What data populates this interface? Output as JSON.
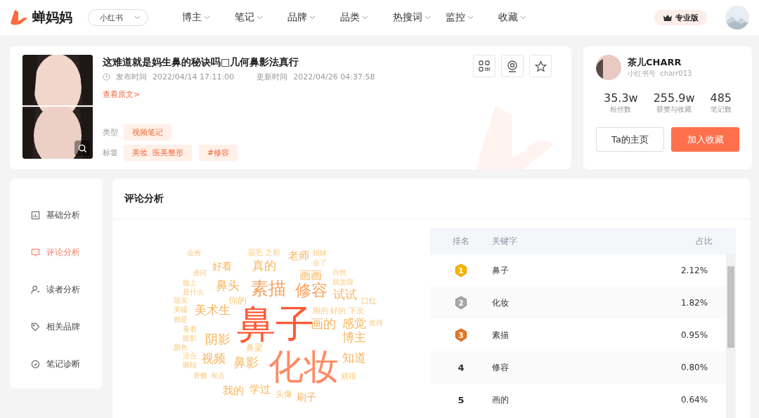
{
  "header": {
    "logo": "蝉妈妈",
    "platform": "小红书",
    "nav": [
      "博主",
      "笔记",
      "品牌",
      "品类",
      "热搜词",
      "监控",
      "收藏"
    ],
    "badge": "专业版"
  },
  "note": {
    "title": "这难道就是妈生鼻的秘诀吗□几何鼻影法真行",
    "published_label": "发布时间",
    "published": "2022/04/14 17:11:00",
    "updated_label": "更新时间",
    "updated": "2022/04/26 04:37:58",
    "link": "查看原文>",
    "type_label": "类型",
    "types": [
      "视频笔记"
    ],
    "tags_label": "标签",
    "tags": [
      "美妆  医美整形",
      "#修容"
    ]
  },
  "author": {
    "name": "茶儿CHARR",
    "id": "小红书号  charr013",
    "stats": [
      {
        "value": "35.3w",
        "label": "粉丝数"
      },
      {
        "value": "255.9w",
        "label": "获赞与收藏"
      },
      {
        "value": "485",
        "label": "笔记数"
      }
    ],
    "buttons": [
      {
        "label": "Ta的主页",
        "kind": "outline"
      },
      {
        "label": "加入收藏",
        "kind": "primary"
      }
    ]
  },
  "sidebar": [
    {
      "label": "基础分析",
      "selected": false
    },
    {
      "label": "评论分析",
      "selected": true
    },
    {
      "label": "读者分析",
      "selected": false
    },
    {
      "label": "相关品牌",
      "selected": false
    },
    {
      "label": "笔记诊断",
      "selected": false
    }
  ],
  "panel": {
    "title": "评论分析",
    "cloud": [
      "会画",
      "眉毛 之前",
      "老师",
      "姐妹",
      "好看",
      "真的",
      "会了",
      "请问",
      "画画",
      "自然",
      "脸上",
      "鼻头",
      "素描",
      "修容",
      "我觉得",
      "是什么",
      "试试",
      "现实",
      "你的",
      "口红",
      "美瞳",
      "美术生",
      "鼻子",
      "用的 好的 下次",
      "都是",
      "画的",
      "感觉",
      "觉得",
      "看着",
      "眼影",
      "阴影",
      "博主",
      "颜色",
      "鼻梁",
      "适合",
      "眼睛",
      "骨骼",
      "视频",
      "有点",
      "鼻影",
      "化妆",
      "知道",
      "就很",
      "我的",
      "学过",
      "头像",
      "刷子"
    ],
    "table": {
      "columns": [
        "排名",
        "关键字",
        "占比"
      ],
      "rows": [
        {
          "rank": "1",
          "kind": "medal",
          "keyword": "鼻子",
          "share": "2.12%"
        },
        {
          "rank": "2",
          "kind": "medal",
          "keyword": "化妆",
          "share": "1.82%"
        },
        {
          "rank": "3",
          "kind": "medal",
          "keyword": "素描",
          "share": "0.95%"
        },
        {
          "rank": "4",
          "kind": "number",
          "keyword": "修容",
          "share": "0.80%"
        },
        {
          "rank": "5",
          "kind": "number",
          "keyword": "画的",
          "share": "0.64%"
        }
      ]
    }
  }
}
